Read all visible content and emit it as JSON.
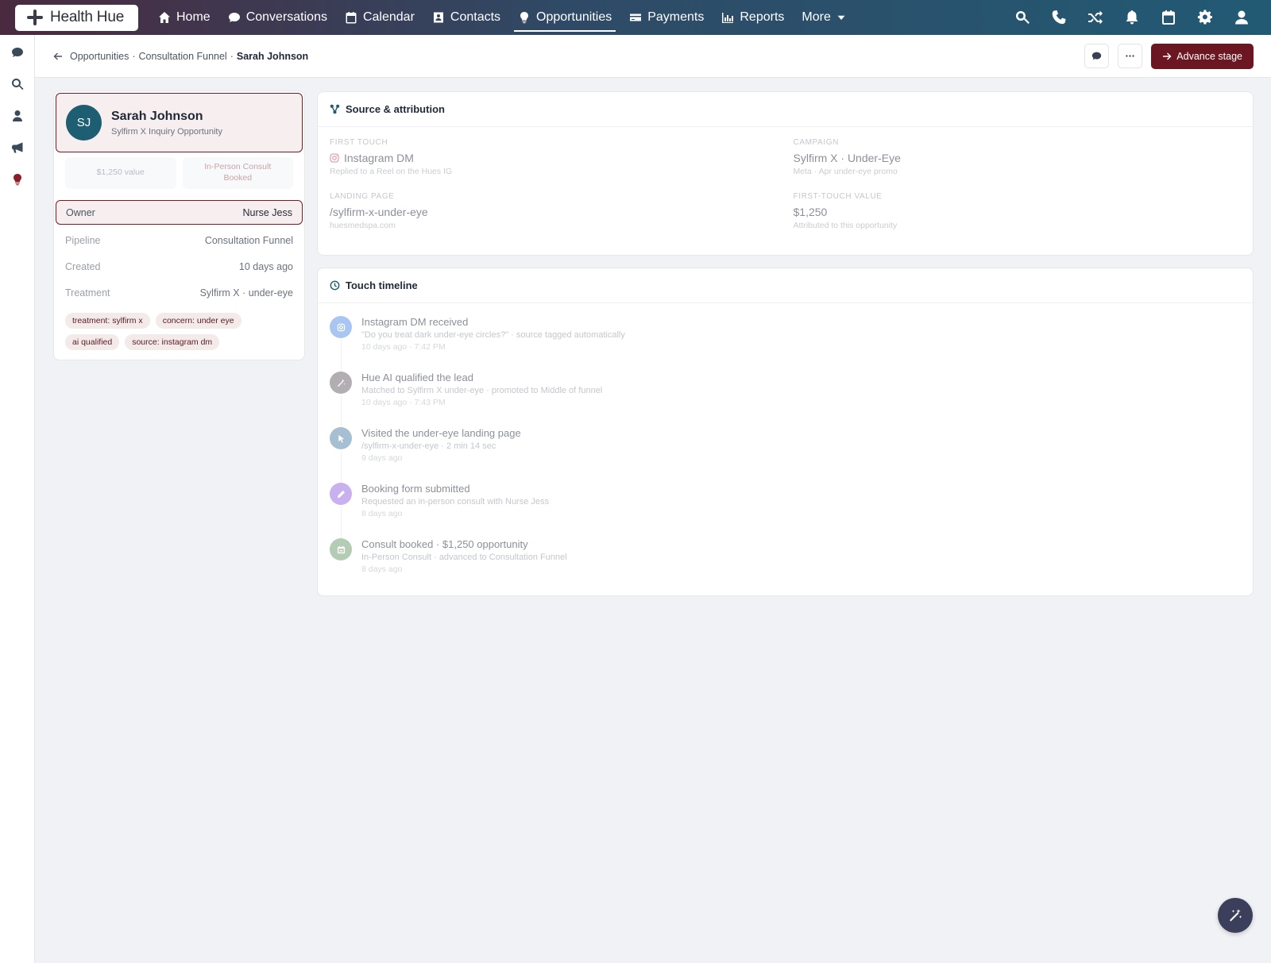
{
  "brand": {
    "name": "Health Hue"
  },
  "nav": {
    "items": [
      {
        "label": "Home",
        "icon": "home-icon"
      },
      {
        "label": "Conversations",
        "icon": "chat-icon"
      },
      {
        "label": "Calendar",
        "icon": "calendar-icon"
      },
      {
        "label": "Contacts",
        "icon": "contact-card-icon"
      },
      {
        "label": "Opportunities",
        "icon": "lightbulb-icon",
        "active": true
      },
      {
        "label": "Payments",
        "icon": "credit-card-icon"
      },
      {
        "label": "Reports",
        "icon": "bar-chart-icon"
      },
      {
        "label": "More",
        "icon": "caret-down-icon"
      }
    ],
    "right_icons": [
      "search-icon",
      "phone-icon",
      "shuffle-icon",
      "bell-icon",
      "calendar-icon",
      "gear-icon",
      "user-icon"
    ]
  },
  "rail": {
    "icons": [
      "chat-icon",
      "search-icon",
      "user-icon",
      "megaphone-icon",
      "lightbulb-icon"
    ]
  },
  "breadcrumb": {
    "part1": "Opportunities",
    "sep1": "·",
    "part2": "Consultation Funnel",
    "sep2": "·",
    "current": "Sarah Johnson"
  },
  "header_actions": {
    "advance_label": "Advance stage"
  },
  "profile": {
    "initials": "SJ",
    "name": "Sarah Johnson",
    "subtitle": "Sylfirm X Inquiry Opportunity",
    "stat_value": "$1,250 value",
    "stat_stage": "In-Person Consult Booked",
    "fields": [
      {
        "key": "Owner",
        "value": "Nurse Jess"
      },
      {
        "key": "Pipeline",
        "value": "Consultation Funnel"
      },
      {
        "key": "Created",
        "value": "10 days ago"
      },
      {
        "key": "Treatment",
        "value": "Sylfirm X · under-eye"
      }
    ],
    "tags": [
      "treatment: sylfirm x",
      "concern: under eye",
      "ai qualified",
      "source: instagram dm"
    ]
  },
  "attribution": {
    "title": "Source & attribution",
    "first_touch": {
      "label": "FIRST TOUCH",
      "value": "Instagram DM",
      "sub": "Replied to a Reel on the Hues IG"
    },
    "campaign": {
      "label": "CAMPAIGN",
      "value": "Sylfirm X · Under-Eye",
      "sub": "Meta · Apr under-eye promo"
    },
    "landing": {
      "label": "LANDING PAGE",
      "value": "/sylfirm-x-under-eye",
      "sub": "huesmedspa.com"
    },
    "ft_value": {
      "label": "FIRST-TOUCH VALUE",
      "value": "$1,250",
      "sub": "Attributed to this opportunity"
    }
  },
  "timeline": {
    "title": "Touch timeline",
    "items": [
      {
        "title": "Instagram DM received",
        "desc": "\"Do you treat dark under-eye circles?\" · source tagged automatically",
        "time": "10 days ago · 7:42 PM",
        "color": "#a9c6f2",
        "icon": "instagram-icon"
      },
      {
        "title": "Hue AI qualified the lead",
        "desc": "Matched to Sylfirm X under-eye · promoted to Middle of funnel",
        "time": "10 days ago · 7:43 PM",
        "color": "#b3aeb2",
        "icon": "magic-wand-icon"
      },
      {
        "title": "Visited the under-eye landing page",
        "desc": "/sylfirm-x-under-eye · 2 min 14 sec",
        "time": "9 days ago",
        "color": "#a6bfd2",
        "icon": "cursor-icon"
      },
      {
        "title": "Booking form submitted",
        "desc": "Requested an in-person consult with Nurse Jess",
        "time": "8 days ago",
        "color": "#c9b0ee",
        "icon": "pencil-icon"
      },
      {
        "title": "Consult booked · $1,250 opportunity",
        "desc": "In-Person Consult · advanced to Consultation Funnel",
        "time": "8 days ago",
        "color": "#b4cbb4",
        "icon": "calendar-check-icon"
      }
    ]
  },
  "colors": {
    "brand_accent": "#6b1620",
    "nav_gradient_start": "#4a2a3f",
    "nav_gradient_end": "#225a74",
    "avatar": "#1d5e72"
  }
}
